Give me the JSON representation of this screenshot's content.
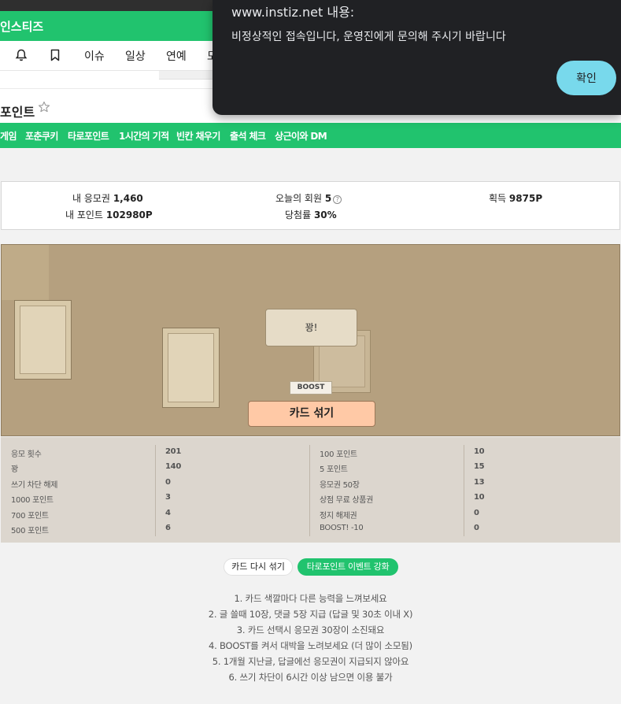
{
  "site": {
    "brand": "인스티즈"
  },
  "nav": {
    "links": [
      "이슈",
      "일상",
      "연예",
      "모"
    ]
  },
  "page": {
    "title": "포인트"
  },
  "tabs": [
    "게임",
    "포춘쿠키",
    "타로포인트",
    "1시간의 기적",
    "빈칸 채우기",
    "출석 체크",
    "상근이와 DM"
  ],
  "stats": {
    "entries_label": "내 응모권",
    "entries_value": "1,460",
    "points_label": "내 포인트",
    "points_value": "102980P",
    "members_label": "오늘의 회원",
    "members_value": "5",
    "winrate_label": "당첨률",
    "winrate_value": "30%",
    "earned_label": "획득",
    "earned_value": "9875P"
  },
  "board": {
    "gwang_label": "꽝!",
    "boost_label": "BOOST",
    "shuffle_label": "카드 섞기"
  },
  "results": {
    "left": [
      {
        "label": "응모 횟수",
        "value": "201"
      },
      {
        "label": "꽝",
        "value": "140"
      },
      {
        "label": "쓰기 차단 해제",
        "value": "0"
      },
      {
        "label": "1000 포인트",
        "value": "3"
      },
      {
        "label": "700 포인트",
        "value": "4"
      },
      {
        "label": "500 포인트",
        "value": "6"
      }
    ],
    "right": [
      {
        "label": "100 포인트",
        "value": "10"
      },
      {
        "label": "5 포인트",
        "value": "15"
      },
      {
        "label": "응모권 50장",
        "value": "13"
      },
      {
        "label": "상점 무료 상품권",
        "value": "10"
      },
      {
        "label": "정지 해제권",
        "value": "0"
      },
      {
        "label": "BOOST! -10",
        "value": "0"
      }
    ]
  },
  "actions": {
    "reshuffle_label": "카드 다시 섞기",
    "event_label": "타로포인트 이벤트 강화"
  },
  "notes": [
    "1. 카드 색깔마다 다른 능력을 느껴보세요",
    "2. 글 쓸때 10장, 댓글 5장 지급 (답글 및 30초 이내 X)",
    "3. 카드 선택시 응모권 30장이 소진돼요",
    "4. BOOST를 켜서 대박을 노려보세요 (더 많이 소모됨)",
    "5. 1개월 지난글, 답글에선 응모권이 지급되지 않아요",
    "6. 쓰기 차단이 6시간 이상 남으면 이용 불가"
  ],
  "dialog": {
    "title": "www.instiz.net 내용:",
    "message": "비정상적인 접속입니다, 운영진에게 문의해 주시기 바랍니다",
    "ok_label": "확인"
  },
  "colors": {
    "brand_green": "#21c36e",
    "dialog_bg": "#202124",
    "ok_button": "#78d9ec",
    "shuffle_button": "#ffc9a6"
  }
}
